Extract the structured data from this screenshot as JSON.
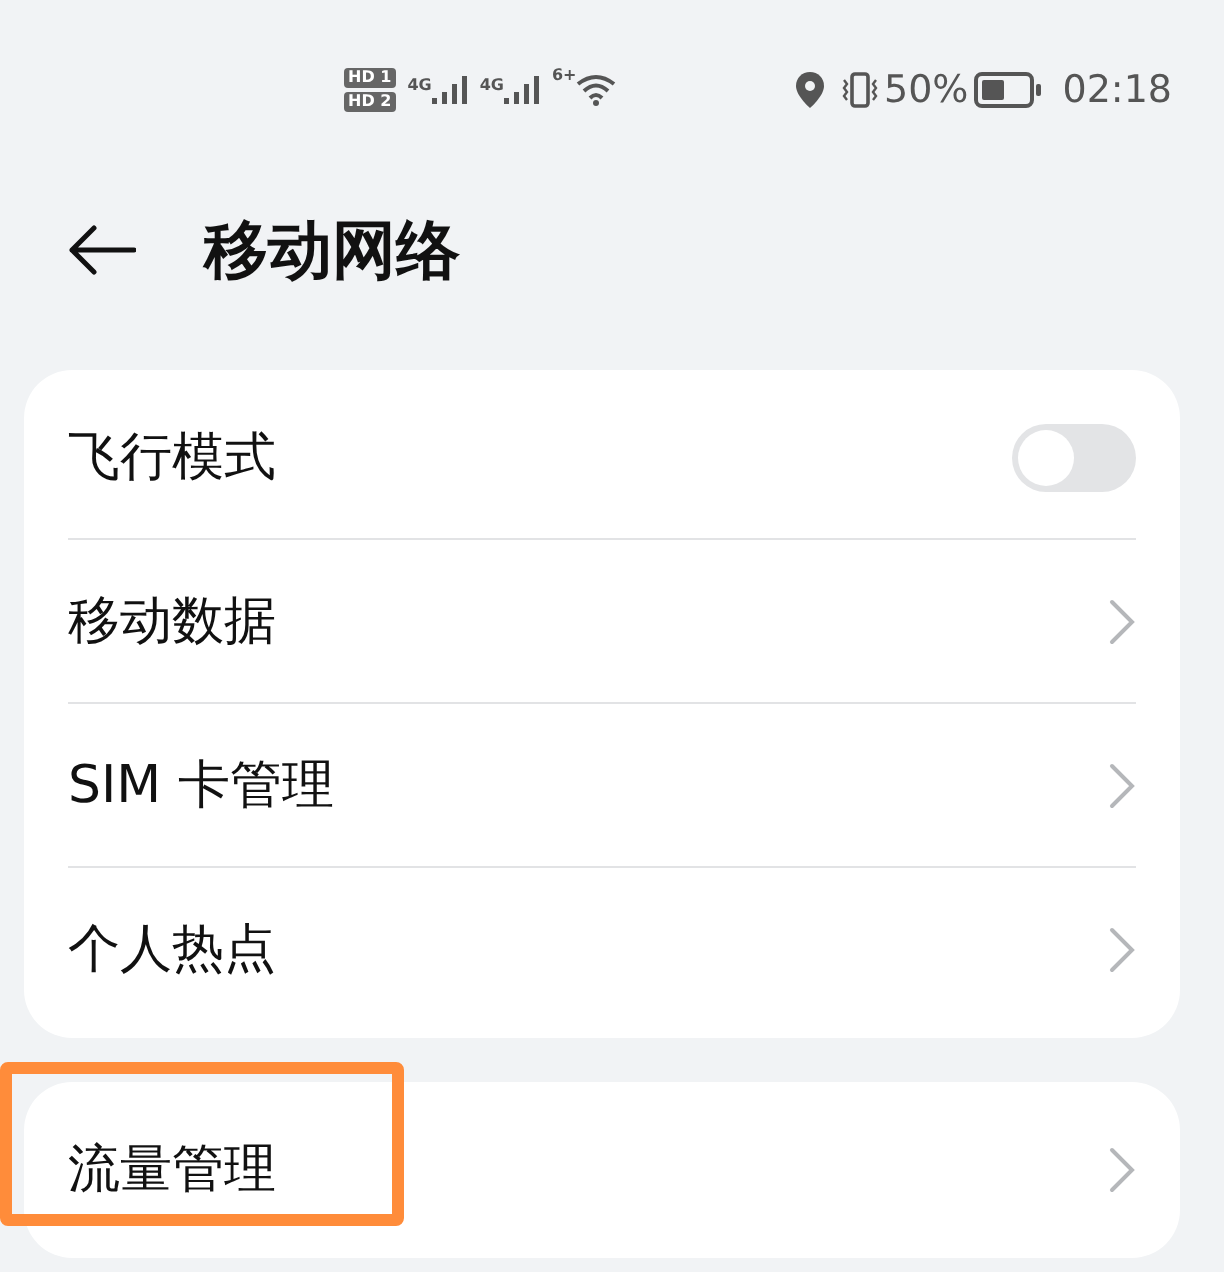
{
  "status_bar": {
    "sims": [
      "HD 1",
      "HD 2"
    ],
    "networks": [
      "4G",
      "4G"
    ],
    "wifi_label": "6+",
    "battery": "50%",
    "time": "02:18"
  },
  "header": {
    "title": "移动网络"
  },
  "groups": [
    {
      "items": [
        {
          "kind": "toggle",
          "label": "飞行模式",
          "on": false,
          "highlighted": false
        },
        {
          "kind": "link",
          "label": "移动数据",
          "highlighted": false
        },
        {
          "kind": "link",
          "label": "SIM 卡管理",
          "highlighted": false
        },
        {
          "kind": "link",
          "label": "个人热点",
          "highlighted": false
        }
      ]
    },
    {
      "items": [
        {
          "kind": "link",
          "label": "流量管理",
          "highlighted": true
        }
      ]
    }
  ]
}
